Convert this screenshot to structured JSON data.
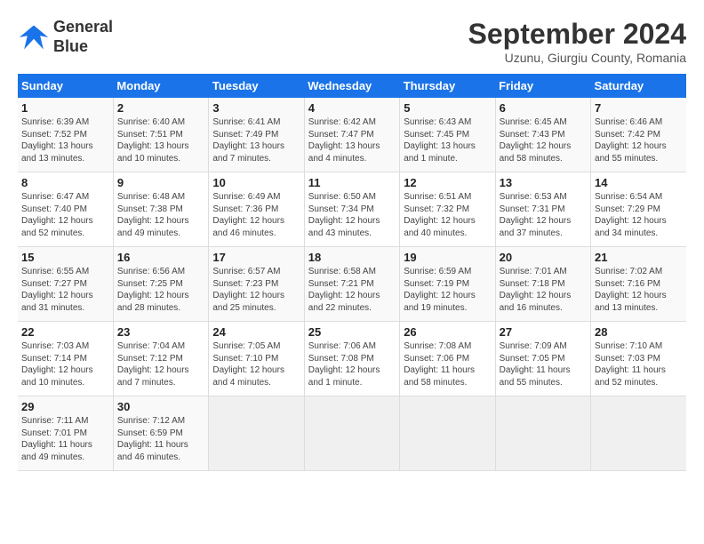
{
  "logo": {
    "line1": "General",
    "line2": "Blue"
  },
  "title": "September 2024",
  "location": "Uzunu, Giurgiu County, Romania",
  "days_of_week": [
    "Sunday",
    "Monday",
    "Tuesday",
    "Wednesday",
    "Thursday",
    "Friday",
    "Saturday"
  ],
  "weeks": [
    [
      {
        "num": "1",
        "info": "Sunrise: 6:39 AM\nSunset: 7:52 PM\nDaylight: 13 hours\nand 13 minutes."
      },
      {
        "num": "2",
        "info": "Sunrise: 6:40 AM\nSunset: 7:51 PM\nDaylight: 13 hours\nand 10 minutes."
      },
      {
        "num": "3",
        "info": "Sunrise: 6:41 AM\nSunset: 7:49 PM\nDaylight: 13 hours\nand 7 minutes."
      },
      {
        "num": "4",
        "info": "Sunrise: 6:42 AM\nSunset: 7:47 PM\nDaylight: 13 hours\nand 4 minutes."
      },
      {
        "num": "5",
        "info": "Sunrise: 6:43 AM\nSunset: 7:45 PM\nDaylight: 13 hours\nand 1 minute."
      },
      {
        "num": "6",
        "info": "Sunrise: 6:45 AM\nSunset: 7:43 PM\nDaylight: 12 hours\nand 58 minutes."
      },
      {
        "num": "7",
        "info": "Sunrise: 6:46 AM\nSunset: 7:42 PM\nDaylight: 12 hours\nand 55 minutes."
      }
    ],
    [
      {
        "num": "8",
        "info": "Sunrise: 6:47 AM\nSunset: 7:40 PM\nDaylight: 12 hours\nand 52 minutes."
      },
      {
        "num": "9",
        "info": "Sunrise: 6:48 AM\nSunset: 7:38 PM\nDaylight: 12 hours\nand 49 minutes."
      },
      {
        "num": "10",
        "info": "Sunrise: 6:49 AM\nSunset: 7:36 PM\nDaylight: 12 hours\nand 46 minutes."
      },
      {
        "num": "11",
        "info": "Sunrise: 6:50 AM\nSunset: 7:34 PM\nDaylight: 12 hours\nand 43 minutes."
      },
      {
        "num": "12",
        "info": "Sunrise: 6:51 AM\nSunset: 7:32 PM\nDaylight: 12 hours\nand 40 minutes."
      },
      {
        "num": "13",
        "info": "Sunrise: 6:53 AM\nSunset: 7:31 PM\nDaylight: 12 hours\nand 37 minutes."
      },
      {
        "num": "14",
        "info": "Sunrise: 6:54 AM\nSunset: 7:29 PM\nDaylight: 12 hours\nand 34 minutes."
      }
    ],
    [
      {
        "num": "15",
        "info": "Sunrise: 6:55 AM\nSunset: 7:27 PM\nDaylight: 12 hours\nand 31 minutes."
      },
      {
        "num": "16",
        "info": "Sunrise: 6:56 AM\nSunset: 7:25 PM\nDaylight: 12 hours\nand 28 minutes."
      },
      {
        "num": "17",
        "info": "Sunrise: 6:57 AM\nSunset: 7:23 PM\nDaylight: 12 hours\nand 25 minutes."
      },
      {
        "num": "18",
        "info": "Sunrise: 6:58 AM\nSunset: 7:21 PM\nDaylight: 12 hours\nand 22 minutes."
      },
      {
        "num": "19",
        "info": "Sunrise: 6:59 AM\nSunset: 7:19 PM\nDaylight: 12 hours\nand 19 minutes."
      },
      {
        "num": "20",
        "info": "Sunrise: 7:01 AM\nSunset: 7:18 PM\nDaylight: 12 hours\nand 16 minutes."
      },
      {
        "num": "21",
        "info": "Sunrise: 7:02 AM\nSunset: 7:16 PM\nDaylight: 12 hours\nand 13 minutes."
      }
    ],
    [
      {
        "num": "22",
        "info": "Sunrise: 7:03 AM\nSunset: 7:14 PM\nDaylight: 12 hours\nand 10 minutes."
      },
      {
        "num": "23",
        "info": "Sunrise: 7:04 AM\nSunset: 7:12 PM\nDaylight: 12 hours\nand 7 minutes."
      },
      {
        "num": "24",
        "info": "Sunrise: 7:05 AM\nSunset: 7:10 PM\nDaylight: 12 hours\nand 4 minutes."
      },
      {
        "num": "25",
        "info": "Sunrise: 7:06 AM\nSunset: 7:08 PM\nDaylight: 12 hours\nand 1 minute."
      },
      {
        "num": "26",
        "info": "Sunrise: 7:08 AM\nSunset: 7:06 PM\nDaylight: 11 hours\nand 58 minutes."
      },
      {
        "num": "27",
        "info": "Sunrise: 7:09 AM\nSunset: 7:05 PM\nDaylight: 11 hours\nand 55 minutes."
      },
      {
        "num": "28",
        "info": "Sunrise: 7:10 AM\nSunset: 7:03 PM\nDaylight: 11 hours\nand 52 minutes."
      }
    ],
    [
      {
        "num": "29",
        "info": "Sunrise: 7:11 AM\nSunset: 7:01 PM\nDaylight: 11 hours\nand 49 minutes."
      },
      {
        "num": "30",
        "info": "Sunrise: 7:12 AM\nSunset: 6:59 PM\nDaylight: 11 hours\nand 46 minutes."
      },
      {
        "num": "",
        "info": ""
      },
      {
        "num": "",
        "info": ""
      },
      {
        "num": "",
        "info": ""
      },
      {
        "num": "",
        "info": ""
      },
      {
        "num": "",
        "info": ""
      }
    ]
  ]
}
